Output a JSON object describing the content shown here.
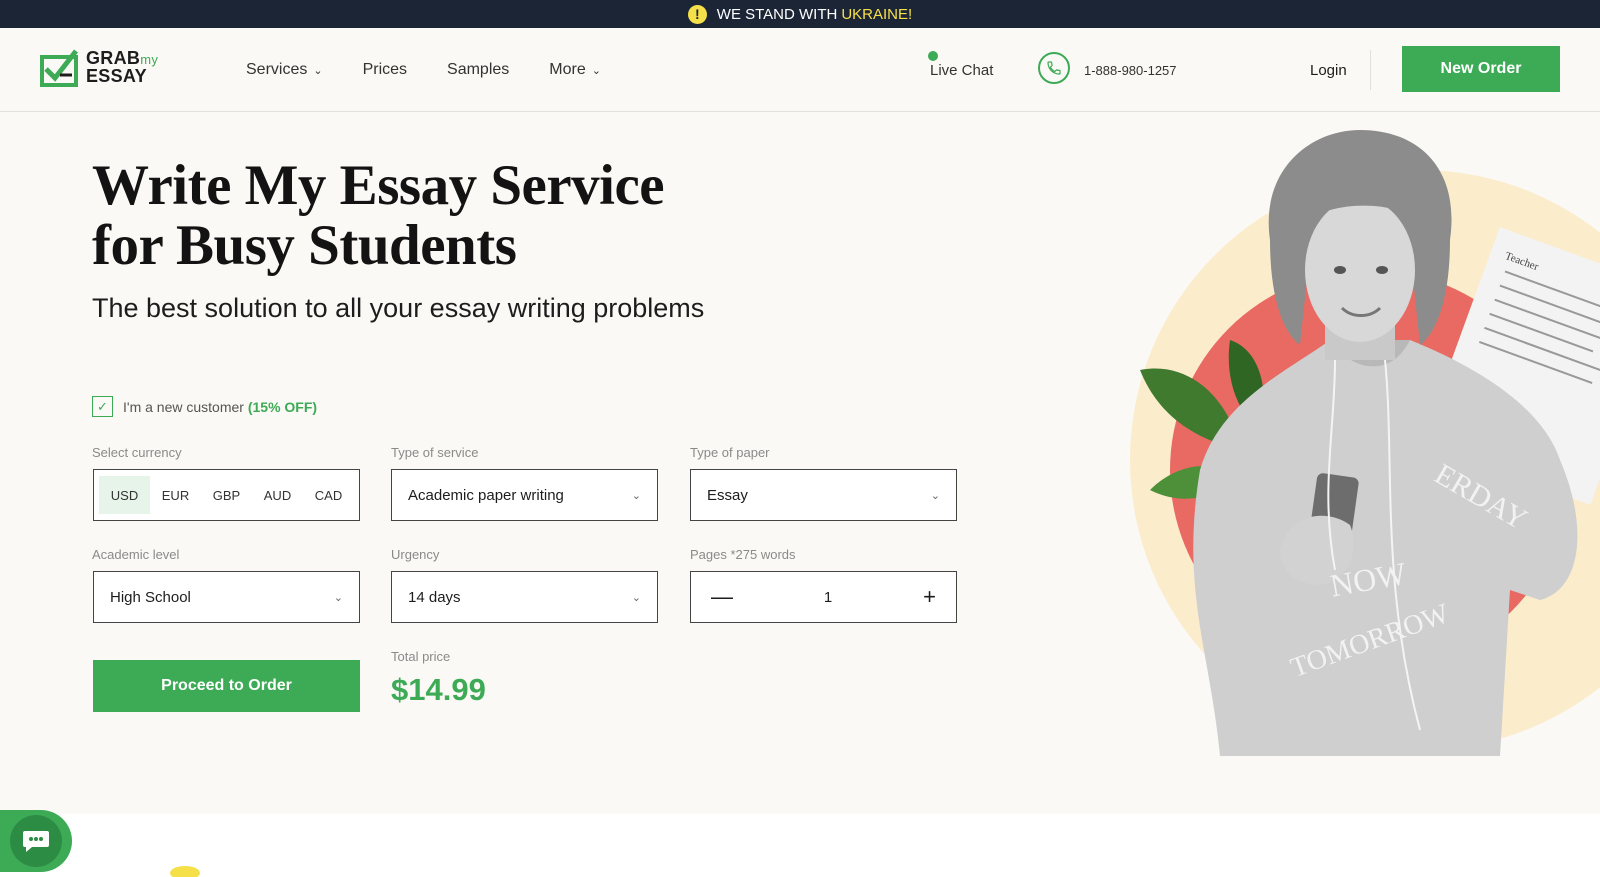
{
  "banner": {
    "text": "WE STAND WITH",
    "highlight": "UKRAINE!"
  },
  "logo": {
    "line1": "GRAB",
    "my": "my",
    "line2": "ESSAY"
  },
  "nav": {
    "services": "Services",
    "prices": "Prices",
    "samples": "Samples",
    "more": "More"
  },
  "header": {
    "live_chat": "Live Chat",
    "phone": "1-888-980-1257",
    "login": "Login",
    "new_order": "New Order"
  },
  "hero": {
    "title_line1": "Write My Essay Service",
    "title_line2": "for Busy Students",
    "subtitle": "The best solution to all your essay writing problems"
  },
  "form": {
    "new_customer": "I'm a new customer",
    "discount": "(15% OFF)",
    "new_customer_checked": true,
    "currency_label": "Select currency",
    "currencies": [
      "USD",
      "EUR",
      "GBP",
      "AUD",
      "CAD"
    ],
    "currency_selected": "USD",
    "service_label": "Type of service",
    "service_value": "Academic paper writing",
    "paper_label": "Type of paper",
    "paper_value": "Essay",
    "level_label": "Academic level",
    "level_value": "High School",
    "urgency_label": "Urgency",
    "urgency_value": "14 days",
    "pages_label": "Pages *275 words",
    "pages_value": "1",
    "total_label": "Total price",
    "total_value": "$14.99",
    "proceed": "Proceed to Order"
  },
  "image_text": {
    "shirt_top": "ERDAY",
    "shirt_mid": "NOW",
    "shirt_bottom": "TOMORROW",
    "paper": "Teacher"
  },
  "colors": {
    "accent": "#3daa56",
    "banner_bg": "#1c2536",
    "banner_highlight": "#f5e04a",
    "page_bg": "#fbf9f5"
  }
}
